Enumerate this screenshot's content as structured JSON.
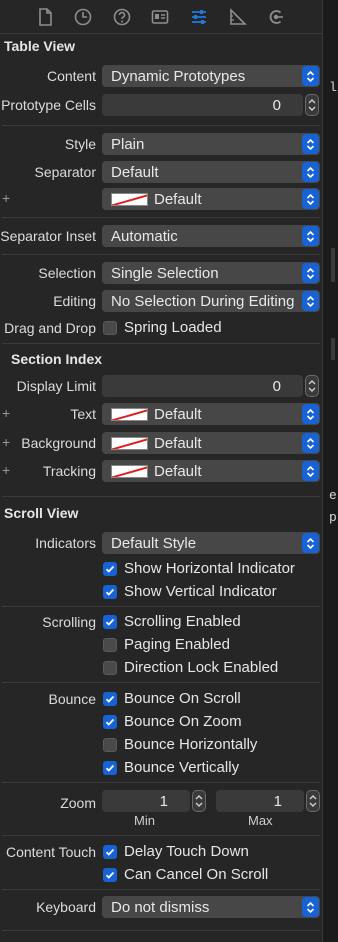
{
  "toolbar": {
    "icons": [
      "file-icon",
      "history-icon",
      "help-icon",
      "identity-icon",
      "attributes-icon",
      "size-icon",
      "connections-icon"
    ],
    "selected": "attributes-icon",
    "accent": "#1f7ae0"
  },
  "table_view": {
    "title": "Table View",
    "content_label": "Content",
    "content_value": "Dynamic Prototypes",
    "prototype_cells_label": "Prototype Cells",
    "prototype_cells_value": "0",
    "style_label": "Style",
    "style_value": "Plain",
    "separator_label": "Separator",
    "separator_value": "Default",
    "separator_color_value": "Default",
    "separator_inset_label": "Separator Inset",
    "separator_inset_value": "Automatic",
    "selection_label": "Selection",
    "selection_value": "Single Selection",
    "editing_label": "Editing",
    "editing_value": "No Selection During Editing",
    "drag_drop_label": "Drag and Drop",
    "spring_loaded_label": "Spring Loaded",
    "spring_loaded_checked": false
  },
  "section_index": {
    "title": "Section Index",
    "display_limit_label": "Display Limit",
    "display_limit_value": "0",
    "text_label": "Text",
    "text_value": "Default",
    "background_label": "Background",
    "background_value": "Default",
    "tracking_label": "Tracking",
    "tracking_value": "Default"
  },
  "scroll_view": {
    "title": "Scroll View",
    "indicators_label": "Indicators",
    "indicators_value": "Default Style",
    "show_h_label": "Show Horizontal Indicator",
    "show_v_label": "Show Vertical Indicator",
    "scrolling_label": "Scrolling",
    "scrolling_enabled_label": "Scrolling Enabled",
    "paging_label": "Paging Enabled",
    "direction_lock_label": "Direction Lock Enabled",
    "bounce_label": "Bounce",
    "bounce_scroll_label": "Bounce On Scroll",
    "bounce_zoom_label": "Bounce On Zoom",
    "bounce_h_label": "Bounce Horizontally",
    "bounce_v_label": "Bounce Vertically",
    "zoom_label": "Zoom",
    "zoom_min_value": "1",
    "zoom_min_label": "Min",
    "zoom_max_value": "1",
    "zoom_max_label": "Max",
    "content_touch_label": "Content Touch",
    "delay_touch_label": "Delay Touch Down",
    "can_cancel_label": "Can Cancel On Scroll",
    "keyboard_label": "Keyboard",
    "keyboard_value": "Do not dismiss"
  },
  "right_edge": {
    "frag1": "li",
    "frag2": "e",
    "frag3": "p"
  },
  "colors": {
    "panel_bg": "#262626",
    "popup_bg": "#474747",
    "accent_blue": "#1763d6"
  }
}
